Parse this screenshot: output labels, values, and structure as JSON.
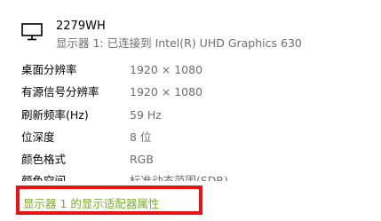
{
  "monitor": {
    "name": "2279WH",
    "subtitle": "显示器 1: 已连接到 Intel(R) UHD Graphics 630",
    "icon": "monitor-icon"
  },
  "properties": [
    {
      "label": "桌面分辨率",
      "value": "1920 × 1080"
    },
    {
      "label": "有源信号分辨率",
      "value": "1920 × 1080"
    },
    {
      "label": "刷新频率(Hz)",
      "value": "59 Hz"
    },
    {
      "label": "位深度",
      "value": "8 位"
    },
    {
      "label": "颜色格式",
      "value": "RGB"
    },
    {
      "label": "颜色空间",
      "value": "标准动态范围(SDR)"
    }
  ],
  "adapter_link": "显示器 1 的显示适配器属性",
  "colors": {
    "link": "#79ad2e",
    "highlight": "#ee1111",
    "secondary_text": "#6e6e6e"
  }
}
